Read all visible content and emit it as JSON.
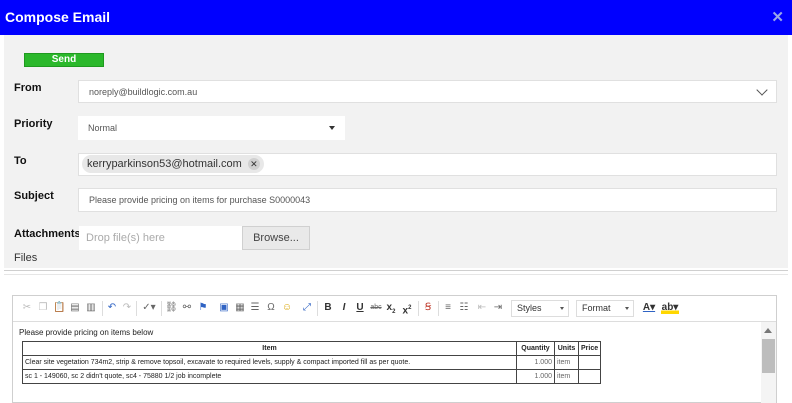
{
  "window": {
    "title": "Compose Email",
    "close_glyph": "✕"
  },
  "actions": {
    "send_label": "Send"
  },
  "labels": {
    "from": "From",
    "priority": "Priority",
    "to": "To",
    "subject": "Subject",
    "attachments": "Attachments",
    "files": "Files"
  },
  "from": {
    "value": "noreply@buildlogic.com.au"
  },
  "priority": {
    "value": "Normal"
  },
  "to": {
    "recipients": [
      {
        "email": "kerryparkinson53@hotmail.com",
        "remove_glyph": "✕"
      }
    ]
  },
  "subject": {
    "value": "Please provide pricing on items for purchase S0000043"
  },
  "attachments": {
    "dropzone_placeholder": "Drop file(s) here",
    "browse_label": "Browse..."
  },
  "editor": {
    "toolbar": {
      "styles_label": "Styles",
      "format_label": "Format",
      "icons": [
        "cut-icon",
        "copy-icon",
        "paste-icon",
        "paste-text-icon",
        "paste-word-icon",
        "undo-icon",
        "redo-icon",
        "spellcheck-icon",
        "link-icon",
        "unlink-icon",
        "anchor-icon",
        "image-icon",
        "table-icon",
        "horizontal-line-icon",
        "special-char-icon",
        "smiley-icon",
        "maximize-icon",
        "bold-icon",
        "italic-icon",
        "underline-icon",
        "strikethrough-icon",
        "subscript-icon",
        "superscript-icon",
        "remove-format-icon",
        "numbered-list-icon",
        "bulleted-list-icon",
        "outdent-icon",
        "indent-icon",
        "text-color-icon",
        "background-color-icon"
      ]
    },
    "intro_text": "Please provide pricing on items below",
    "table": {
      "headers": [
        "Item",
        "Quantity",
        "Units",
        "Price"
      ],
      "rows": [
        [
          "Clear site vegetation 734m2, strip & remove topsoil, excavate to required levels, supply & compact imported fill as per quote.",
          "1.000",
          "item",
          ""
        ],
        [
          "sc 1 - 149060, sc 2 didn't quote, sc4 - 75880 1/2 job incomplete",
          "1.000",
          "item",
          ""
        ]
      ]
    }
  },
  "colors": {
    "titlebar": "#0000ff",
    "send": "#2bb82b"
  }
}
